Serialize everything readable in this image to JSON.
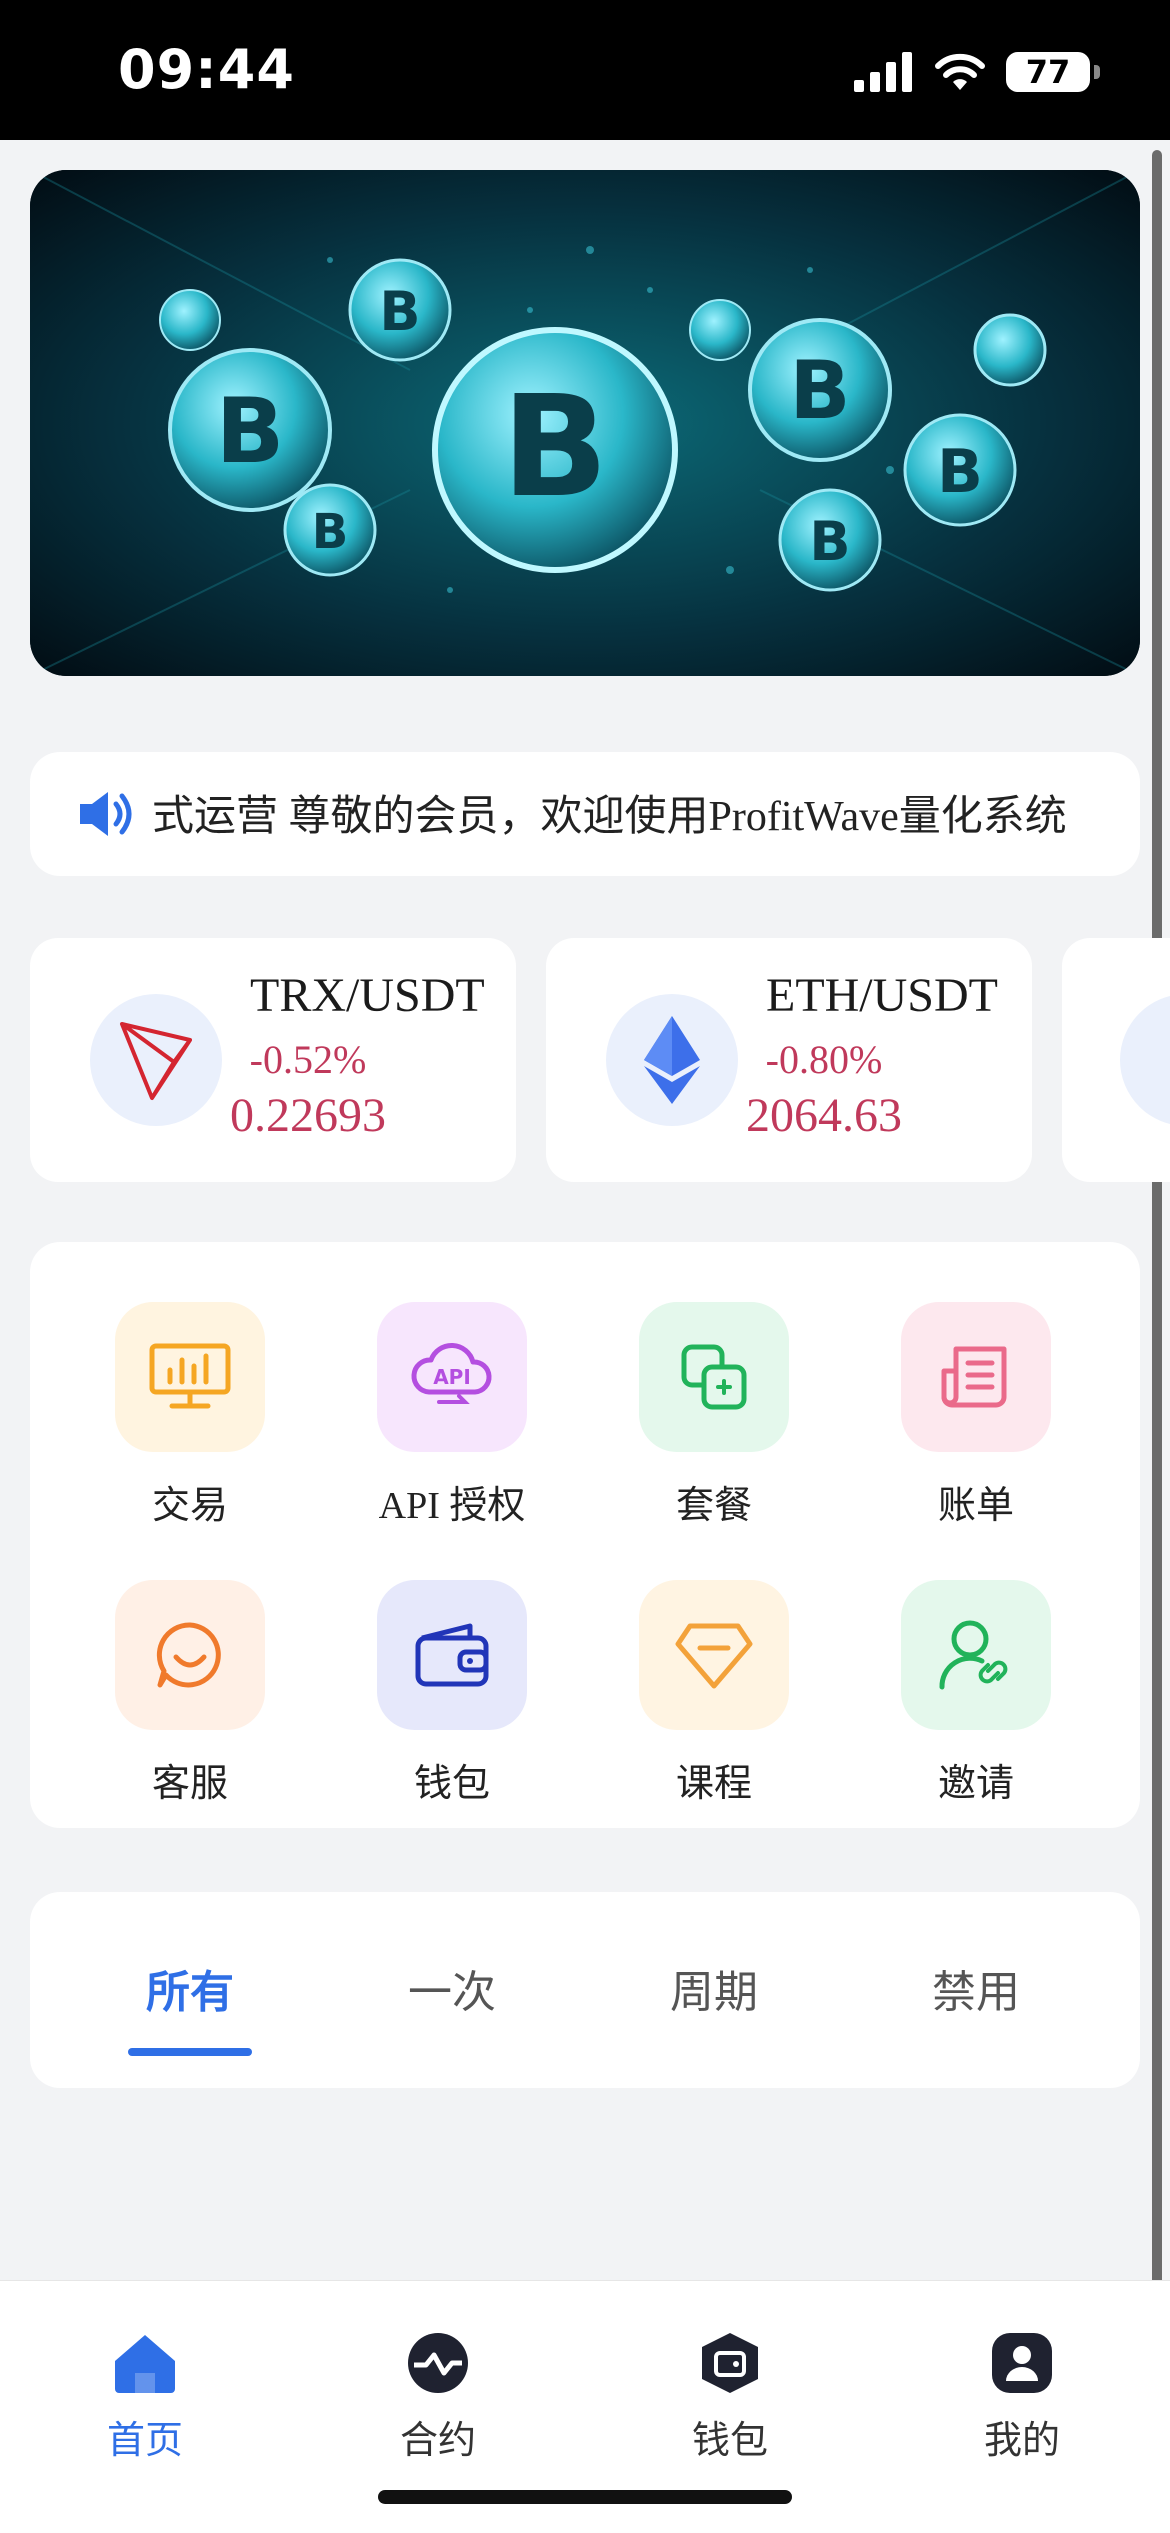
{
  "status_bar": {
    "time": "09:44",
    "battery": "77"
  },
  "notice": {
    "text": "式运营 尊敬的会员，欢迎使用ProfitWave量化系统"
  },
  "markets": [
    {
      "pair": "TRX/USDT",
      "change": "-0.52%",
      "price": "0.22693",
      "icon": "tron-icon"
    },
    {
      "pair": "ETH/USDT",
      "change": "-0.80%",
      "price": "2064.63",
      "icon": "ethereum-icon"
    }
  ],
  "grid": {
    "items": [
      {
        "label": "交易",
        "icon": "monitor-chart-icon",
        "color": "#f5a623",
        "bg": "#fff4e0"
      },
      {
        "label": "API 授权",
        "icon": "api-cloud-icon",
        "color": "#b44fe0",
        "bg": "#f7e6fd"
      },
      {
        "label": "套餐",
        "icon": "package-icon",
        "color": "#21b35a",
        "bg": "#e4f8ec"
      },
      {
        "label": "账单",
        "icon": "bill-icon",
        "color": "#ea6a8a",
        "bg": "#fde8ee"
      },
      {
        "label": "客服",
        "icon": "chat-icon",
        "color": "#f07a2c",
        "bg": "#fff0e6"
      },
      {
        "label": "钱包",
        "icon": "wallet-icon",
        "color": "#2135b8",
        "bg": "#e6e8fb"
      },
      {
        "label": "课程",
        "icon": "diamond-icon",
        "color": "#f3a23a",
        "bg": "#fff4e2"
      },
      {
        "label": "邀请",
        "icon": "invite-user-icon",
        "color": "#21b35a",
        "bg": "#e4f8ec"
      }
    ]
  },
  "tabs": [
    "所有",
    "一次",
    "周期",
    "禁用"
  ],
  "bottom_nav": [
    "首页",
    "合约",
    "钱包",
    "我的"
  ],
  "colors": {
    "accent": "#2f6fe6",
    "negative": "#c0395b"
  }
}
